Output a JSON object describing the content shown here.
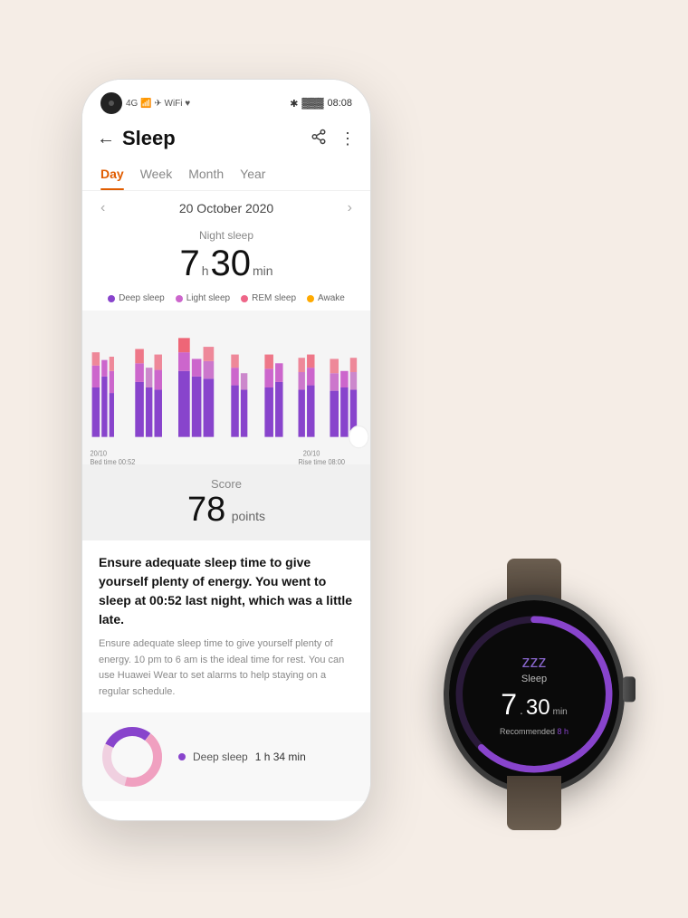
{
  "statusBar": {
    "time": "08:08",
    "signal": "4G",
    "wifi": "WiFi",
    "battery": "🔋"
  },
  "header": {
    "title": "Sleep",
    "backLabel": "←",
    "shareIcon": "share",
    "moreIcon": "more"
  },
  "tabs": {
    "items": [
      "Day",
      "Week",
      "Month",
      "Year"
    ],
    "activeIndex": 0
  },
  "dateNav": {
    "prev": "‹",
    "next": "›",
    "date": "20 October 2020"
  },
  "sleepData": {
    "nightSleepLabel": "Night sleep",
    "hours": "7",
    "hoursUnit": "h",
    "minutes": "30",
    "minutesUnit": "min"
  },
  "legend": [
    {
      "color": "#8844cc",
      "label": "Deep sleep"
    },
    {
      "color": "#cc66cc",
      "label": "Light sleep"
    },
    {
      "color": "#ee6688",
      "label": "REM sleep"
    },
    {
      "color": "#ffaa00",
      "label": "Awake"
    }
  ],
  "chartLabels": {
    "left": {
      "date": "20/10",
      "time": "Bed time 00:52"
    },
    "right": {
      "date": "20/10",
      "time": "Rise time 08:00"
    }
  },
  "score": {
    "label": "Score",
    "value": "78",
    "unit": "points"
  },
  "description": {
    "bold": "Ensure adequate sleep time to give yourself plenty of energy. You went to sleep at 00:52 last night, which was a little late.",
    "normal": "Ensure adequate sleep time to give yourself plenty of energy. 10 pm to 6 am is the ideal time for rest. You can use Huawei Wear to set alarms to help staying on a regular schedule."
  },
  "donutData": {
    "items": [
      {
        "color": "#8844cc",
        "label": "Deep sleep",
        "time": "1 h 34 min"
      }
    ]
  },
  "watch": {
    "sleepIcon": "zzz",
    "sleepLabel": "Sleep",
    "hours": "7",
    "dot": ".",
    "minutes": "30",
    "minLabel": "min",
    "recommended": "Recommended",
    "recommendedHours": "8 h",
    "progressColor": "#8844cc",
    "progressBg": "#2a1a3a"
  }
}
